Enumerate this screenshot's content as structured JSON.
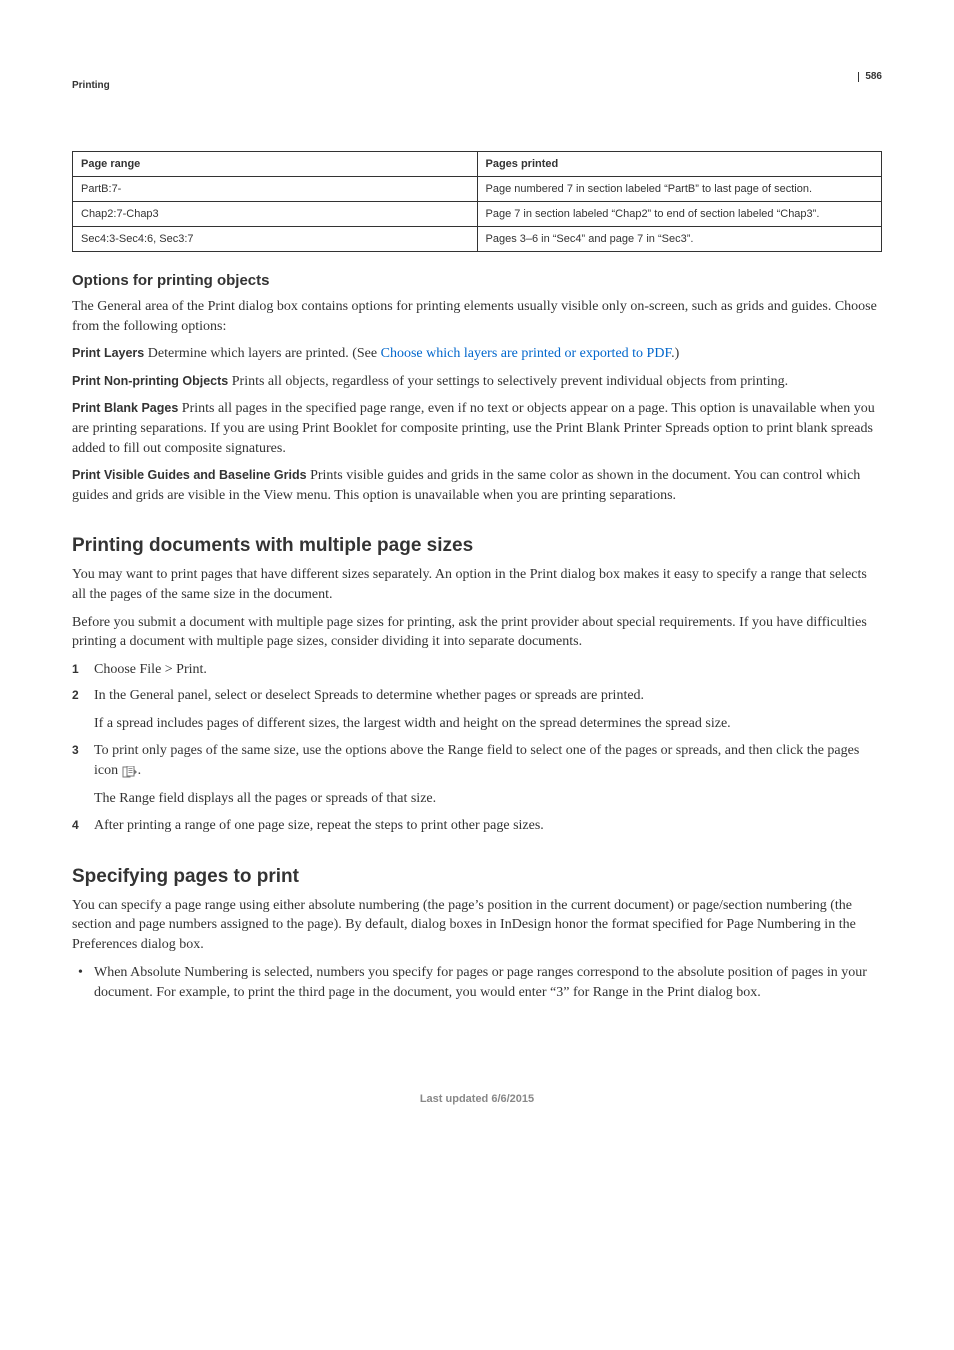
{
  "header": {
    "section": "Printing",
    "pagenum": "586"
  },
  "table": {
    "head": {
      "c1": "Page range",
      "c2": "Pages printed"
    },
    "rows": [
      {
        "c1": "PartB:7-",
        "c2": "Page numbered 7 in section labeled “PartB” to last page of section."
      },
      {
        "c1": "Chap2:7-Chap3",
        "c2": "Page 7 in section labeled “Chap2” to end of section labeled “Chap3”."
      },
      {
        "c1": "Sec4:3-Sec4:6, Sec3:7",
        "c2": "Pages 3–6 in “Sec4” and page 7 in “Sec3”."
      }
    ]
  },
  "options": {
    "heading": "Options for printing objects",
    "intro": "The General area of the Print dialog box contains options for printing elements usually visible only on-screen, such as grids and guides. Choose from the following options:",
    "printLayers": {
      "label": "Print Layers",
      "text_before": "Determine which layers are printed. (See ",
      "link": "Choose which layers are printed or exported to PDF",
      "text_after": ".)"
    },
    "printNon": {
      "label": "Print Non-printing Objects",
      "text": "Prints all objects, regardless of your settings to selectively prevent individual objects from printing."
    },
    "printBlank": {
      "label": "Print Blank Pages",
      "text": "Prints all pages in the specified page range, even if no text or objects appear on a page. This option is unavailable when you are printing separations. If you are using Print Booklet for composite printing, use the Print Blank Printer Spreads option to print blank spreads added to fill out composite signatures."
    },
    "printVisible": {
      "label": "Print Visible Guides and Baseline Grids",
      "text": "Prints visible guides and grids in the same color as shown in the document. You can control which guides and grids are visible in the View menu. This option is unavailable when you are printing separations."
    }
  },
  "multi": {
    "heading": "Printing documents with multiple page sizes",
    "p1": "You may want to print pages that have different sizes separately. An option in the Print dialog box makes it easy to specify a range that selects all the pages of the same size in the document.",
    "p2": "Before you submit a document with multiple page sizes for printing, ask the print provider about special requirements. If you have difficulties printing a document with multiple page sizes, consider dividing it into separate documents.",
    "steps": {
      "n1": "1",
      "s1": "Choose File > Print.",
      "n2": "2",
      "s2": "In the General panel, select or deselect Spreads to determine whether pages or spreads are printed.",
      "s2b": "If a spread includes pages of different sizes, the largest width and height on the spread determines the spread size.",
      "n3": "3",
      "s3a": "To print only pages of the same size, use the options above the Range field to select one of the pages or spreads, and then click the pages icon ",
      "s3b": ".",
      "s3c": "The Range field displays all the pages or spreads of that size.",
      "n4": "4",
      "s4": "After printing a range of one page size, repeat the steps to print other page sizes."
    }
  },
  "specify": {
    "heading": "Specifying pages to print",
    "p1": "You can specify a page range using either absolute numbering (the page’s position in the current document) or page/section numbering (the section and page numbers assigned to the page). By default, dialog boxes in InDesign honor the format specified for Page Numbering in the Preferences dialog box.",
    "b1": "When Absolute Numbering is selected, numbers you specify for pages or page ranges correspond to the absolute position of pages in your document. For example, to print the third page in the document, you would enter “3” for Range in the Print dialog box."
  },
  "footer": "Last updated 6/6/2015"
}
